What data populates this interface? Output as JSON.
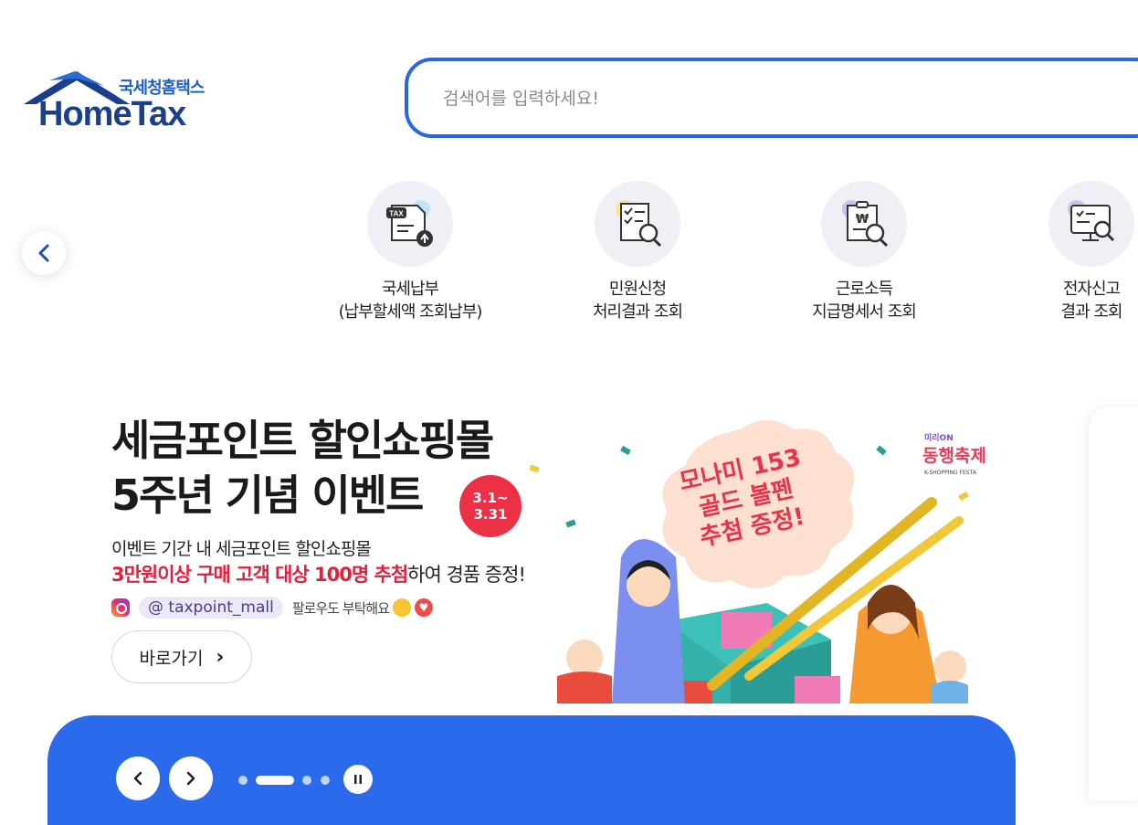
{
  "brand": {
    "subtitle": "국세청홈택스",
    "name": "HomeTax"
  },
  "search": {
    "placeholder": "검색어를 입력하세요!"
  },
  "quick_menu": {
    "prev_icon": "chevron-left-icon",
    "items": [
      {
        "line1": "국세납부",
        "line2": "(납부할세액 조회납부)",
        "icon": "tax-upload-icon"
      },
      {
        "line1": "민원신청",
        "line2": "처리결과 조회",
        "icon": "document-search-icon"
      },
      {
        "line1": "근로소득",
        "line2": "지급명세서 조회",
        "icon": "won-document-search-icon"
      },
      {
        "line1": "전자신고",
        "line2": "결과 조회",
        "icon": "monitor-search-icon"
      }
    ]
  },
  "banner": {
    "title_line1": "세금포인트 할인쇼핑몰",
    "title_line2": "5주년 기념 이벤트",
    "date_line1": "3.1~",
    "date_line2": "3.31",
    "desc_line1": "이벤트 기간 내 세금포인트 할인쇼핑몰",
    "desc_highlight": "3만원이상 구매 고객 대상 100명 추첨",
    "desc_rest": "하여 경품 증정!",
    "insta_handle": "@ taxpoint_mall",
    "insta_note": "팔로우도 부탁해요",
    "button_label": "바로가기",
    "prize_line1": "모나미 153",
    "prize_line2": "골드 볼펜",
    "prize_line3": "추첨 증정!",
    "festival_top": "미리ON",
    "festival_name": "동행축제",
    "festival_sub": "K-SHOPPING FESTA"
  },
  "carousel": {
    "prev_icon": "chevron-left-icon",
    "next_icon": "chevron-right-icon",
    "pause_icon": "pause-icon",
    "dot_count": 4,
    "active_index": 1
  },
  "colors": {
    "primary": "#2767e4",
    "brand_dark": "#1a3f8f",
    "highlight_red": "#e31f3c",
    "bottom_bar": "#2b6aea"
  }
}
